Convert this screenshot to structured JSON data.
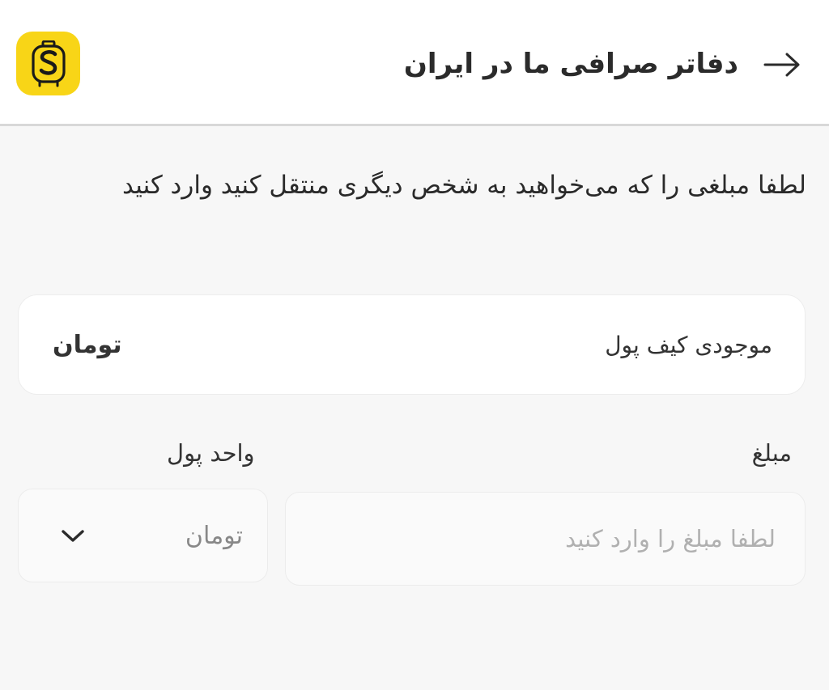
{
  "header": {
    "title": "دفاتر صرافی ما در ایران",
    "back_icon": "arrow-right-icon",
    "logo_icon": "exchange-logo-icon",
    "logo_color": "#f8d517"
  },
  "instruction": "لطفا مبلغی را که می‌خواهید به شخص دیگری منتقل کنید وارد کنید",
  "wallet": {
    "label": "موجودی کیف پول",
    "value": "تومان"
  },
  "form": {
    "amount_label": "مبلغ",
    "amount_placeholder": "لطفا مبلغ را وارد کنید",
    "amount_value": "",
    "unit_label": "واحد پول",
    "unit_selected": "تومان",
    "unit_icon": "chevron-down-icon"
  }
}
